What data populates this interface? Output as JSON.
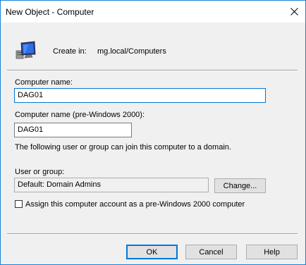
{
  "window": {
    "title": "New Object - Computer"
  },
  "header": {
    "create_in_label": "Create in:",
    "create_in_value": "mg.local/Computers"
  },
  "form": {
    "computer_name_label": "Computer name:",
    "computer_name_value": "DAG01",
    "pre2000_label": "Computer name (pre-Windows 2000):",
    "pre2000_value": "DAG01",
    "join_text": "The following user or group can join this computer to a domain.",
    "user_group_label": "User or group:",
    "user_group_value": "Default: Domain Admins",
    "change_button": "Change...",
    "assign_checkbox_label": "Assign this computer account as a pre-Windows 2000 computer",
    "assign_checked": false
  },
  "buttons": {
    "ok": "OK",
    "cancel": "Cancel",
    "help": "Help"
  },
  "icons": {
    "computer": "computer-icon",
    "close": "close-icon"
  },
  "colors": {
    "accent": "#0078d7",
    "window_border": "#1883d7"
  }
}
